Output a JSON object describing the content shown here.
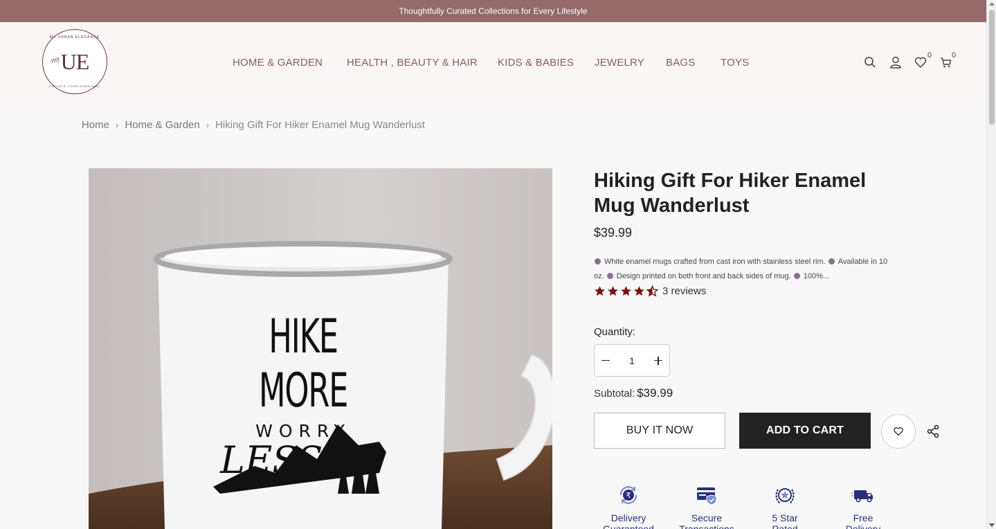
{
  "announcement": "Thoughtfully Curated Collections for Every Lifestyle",
  "logo": {
    "ring_top": "MY URBAN ELEGANCE",
    "mark": "UE",
    "my": "my",
    "ring_bottom": "ELEVATE YOUR EVERYDAY"
  },
  "nav": {
    "items": [
      {
        "label": "HOME & GARDEN"
      },
      {
        "label": "HEALTH , BEAUTY & HAIR"
      },
      {
        "label": "KIDS & BABIES"
      },
      {
        "label": "JEWELRY"
      },
      {
        "label": "BAGS"
      },
      {
        "label": "TOYS"
      }
    ]
  },
  "header_icons": {
    "search": "search-icon",
    "account": "user-icon",
    "wishlist": "heart-icon",
    "wishlist_count": "0",
    "cart": "cart-icon",
    "cart_count": "0"
  },
  "breadcrumb": {
    "items": [
      "Home",
      "Home & Garden",
      "Hiking Gift For Hiker Enamel Mug Wanderlust"
    ]
  },
  "product": {
    "title": "Hiking Gift For Hiker Enamel Mug Wanderlust",
    "price": "$39.99",
    "description": [
      "White enamel mugs crafted from cast iron with stainless steel rim.",
      "Available in 10 oz.",
      "Design printed on both front and back sides of mug.",
      "100%..."
    ],
    "rating": 4.5,
    "reviews": "3 reviews",
    "quantity_label": "Quantity:",
    "quantity": "1",
    "subtotal_label": "Subtotal:",
    "subtotal": "$39.99",
    "buy_now": "BUY IT NOW",
    "add_to_cart": "ADD TO CART",
    "image_text": {
      "line1": "HIKE MORE",
      "line2": "WORRY",
      "line3": "LESS."
    }
  },
  "badges": [
    {
      "line1": "Delivery",
      "line2": "Guaranteed",
      "icon": "rupee-refresh-icon"
    },
    {
      "line1": "Secure",
      "line2": "Transactions",
      "icon": "credit-card-icon"
    },
    {
      "line1": "5 Star",
      "line2": "Rated",
      "icon": "star-award-icon"
    },
    {
      "line1": "Free",
      "line2": "Delivery",
      "icon": "delivery-truck-icon"
    }
  ],
  "colors": {
    "announcement_bg": "#946a6a",
    "nav_text": "#8a5c5c",
    "star": "#7a1212",
    "badge_text": "#2a2f7a",
    "button_dark": "#222222"
  }
}
